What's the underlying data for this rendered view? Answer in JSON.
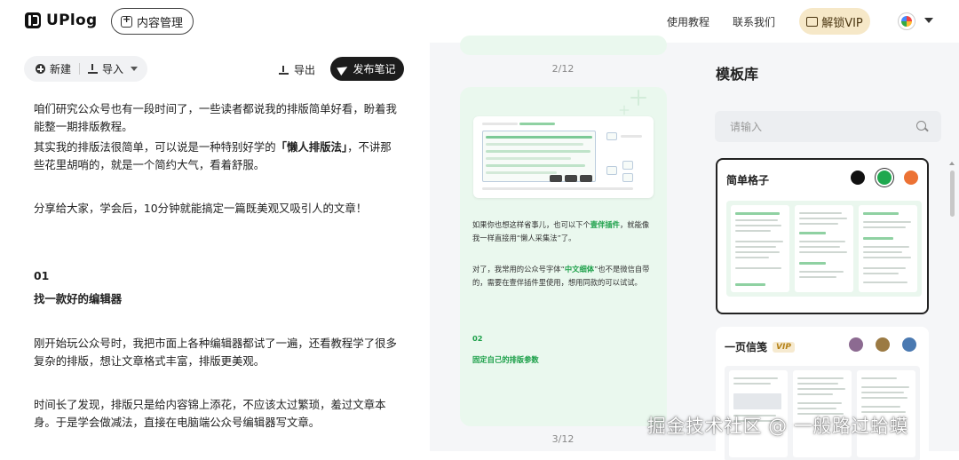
{
  "header": {
    "logo_text": "UPlog",
    "content_mgmt_label": "内容管理",
    "nav": [
      "使用教程",
      "联系我们"
    ],
    "vip_label": "解锁VIP"
  },
  "editor": {
    "toolbar": {
      "new_label": "新建",
      "import_label": "导入",
      "export_label": "导出",
      "publish_label": "发布笔记"
    },
    "paragraphs": [
      "咱们研究公众号也有一段时间了，一些读者都说我的排版简单好看，盼着我能整一期排版教程。",
      "其实我的排版法很简单，可以说是一种特别好学的",
      "「懒人排版法」",
      "，不讲那些花里胡哨的，就是一个简约大气，看着舒服。",
      "分享给大家，学会后，10分钟就能搞定一篇既美观又吸引人的文章！",
      "01",
      "找一款好的编辑器",
      "刚开始玩公众号时，我把市面上各种编辑器都试了一遍，还看教程学了很多复杂的排版，想让文章格式丰富，排版更美观。",
      "时间长了发现，排版只是给内容锦上添花，不应该太过繁琐，羞过文章本身。于是学会做减法，直接在电脑端公众号编辑器写文章。"
    ]
  },
  "preview": {
    "page_indicator_1": "2/12",
    "page_indicator_2": "3/12",
    "p1_a": "如果你也想这样省事儿，也可以下个",
    "p1_link": "壹伴插件",
    "p1_b": "，就能像我一样直接用“懒人采集法”了。",
    "p2_a": "对了，我常用的公众号字体“",
    "p2_link": "中文细体",
    "p2_b": "”也不是微信自带的，需要在壹伴插件里使用，想用同款的可以试试。",
    "section_num": "02",
    "section_title": "固定自己的排版参数"
  },
  "templates": {
    "title": "模板库",
    "search_placeholder": "请输入",
    "items": [
      {
        "name": "简单格子",
        "vip": false,
        "colors": [
          "#111111",
          "#1fa84f",
          "#ec7234"
        ]
      },
      {
        "name": "一页信笺",
        "vip": true,
        "vip_tag": "VIP",
        "colors": [
          "#8c6a91",
          "#9b7a43",
          "#4a79b1"
        ]
      }
    ],
    "thumb_texts": [
      "UPlog: 让排版更高效，让表达更简单",
      "UPlog",
      "为什么选择UPlog",
      "UPlog: 让创作更高效，让表达更简单",
      "为什么选择UPlog"
    ]
  },
  "watermark": "掘金技术社区 @ 一般路过蛤蟆"
}
